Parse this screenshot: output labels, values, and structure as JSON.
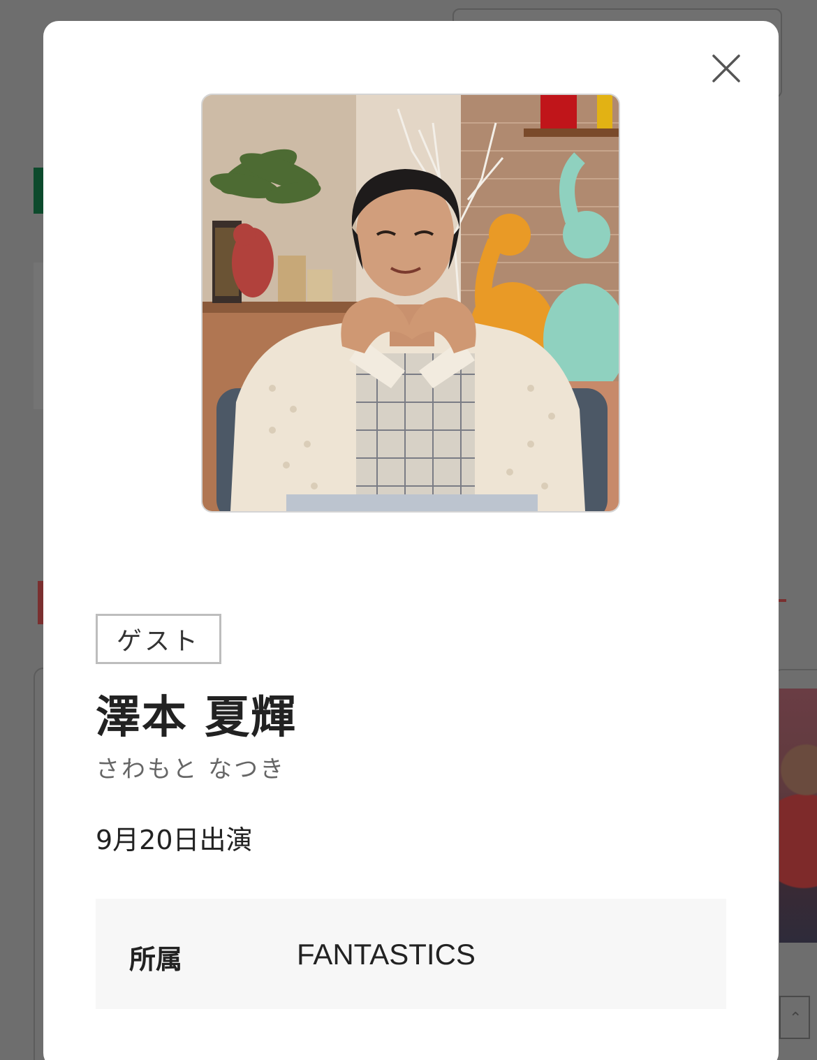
{
  "modal": {
    "close_icon": "close-icon",
    "photo_alt": "澤本 夏輝",
    "role_tag": "ゲスト",
    "name": "澤本 夏輝",
    "reading": "さわもと なつき",
    "appearance_date": "9月20日出演",
    "info": {
      "label": "所属",
      "value": "FANTASTICS"
    }
  },
  "colors": {
    "overlay": "#6e6e6e",
    "modal_bg": "#ffffff",
    "tag_border": "#bdbdbd",
    "info_bg": "#f7f7f7",
    "text_primary": "#222222",
    "text_secondary": "#666666"
  }
}
